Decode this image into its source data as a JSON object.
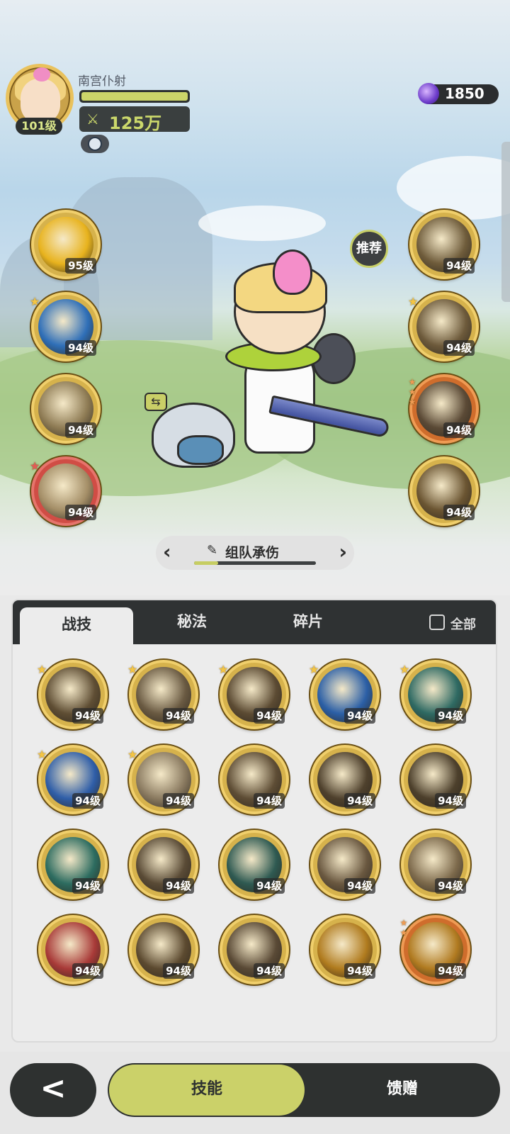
{
  "player": {
    "name": "南宫仆射",
    "level": "101级",
    "hp_fraction": 1.0,
    "power": "125万"
  },
  "currency": {
    "icon": "purple-gem-icon",
    "amount": "1850"
  },
  "recommend_label": "推荐",
  "left_skills": [
    {
      "level": "95级",
      "star": "",
      "theme": "gold",
      "fill": "#e8b31e"
    },
    {
      "level": "94级",
      "star": "★",
      "theme": "gold",
      "fill": "#2f6fb8"
    },
    {
      "level": "94级",
      "star": "",
      "theme": "gold",
      "fill": "#8e7b54"
    },
    {
      "level": "94级",
      "star": "★",
      "theme": "red",
      "fill": "#a48e67"
    }
  ],
  "right_skills": [
    {
      "level": "94级",
      "star": "",
      "theme": "gold",
      "fill": "#6f5c3b"
    },
    {
      "level": "94级",
      "star": "★",
      "theme": "gold",
      "fill": "#6d5a3b"
    },
    {
      "level": "94级",
      "star": "★★★",
      "theme": "orange",
      "fill": "#5b4a36"
    },
    {
      "level": "94级",
      "star": "",
      "theme": "gold",
      "fill": "#6b5532"
    }
  ],
  "preset": {
    "name": "组队承伤",
    "progress": 0.2
  },
  "tabs": [
    {
      "label": "战技",
      "active": true
    },
    {
      "label": "秘法",
      "active": false
    },
    {
      "label": "碎片",
      "active": false
    }
  ],
  "filter_all_label": "全部",
  "grid_skills": [
    {
      "level": "94级",
      "star": "★",
      "theme": "gold",
      "fill": "#5f4e34"
    },
    {
      "level": "94级",
      "star": "★",
      "theme": "gold",
      "fill": "#6a5a42"
    },
    {
      "level": "94级",
      "star": "★",
      "theme": "gold",
      "fill": "#5c4b33"
    },
    {
      "level": "94级",
      "star": "★",
      "theme": "gold",
      "fill": "#2b5fa6"
    },
    {
      "level": "94级",
      "star": "★",
      "theme": "gold",
      "fill": "#2f6a63"
    },
    {
      "level": "94级",
      "star": "★",
      "theme": "gold",
      "fill": "#2f5ea8"
    },
    {
      "level": "94级",
      "star": "★",
      "theme": "gold",
      "fill": "#8a7a60"
    },
    {
      "level": "94级",
      "star": "",
      "theme": "gold",
      "fill": "#5e4d35"
    },
    {
      "level": "94级",
      "star": "",
      "theme": "gold",
      "fill": "#4f412d"
    },
    {
      "level": "94级",
      "star": "",
      "theme": "gold",
      "fill": "#4d402c"
    },
    {
      "level": "94级",
      "star": "",
      "theme": "gold",
      "fill": "#2d6c60"
    },
    {
      "level": "94级",
      "star": "",
      "theme": "gold",
      "fill": "#5a4b36"
    },
    {
      "level": "94级",
      "star": "",
      "theme": "gold",
      "fill": "#2f5a52"
    },
    {
      "level": "94级",
      "star": "",
      "theme": "gold",
      "fill": "#6a5840"
    },
    {
      "level": "94级",
      "star": "",
      "theme": "gold",
      "fill": "#7d6a4c"
    },
    {
      "level": "94级",
      "star": "",
      "theme": "gold",
      "fill": "#a83a38"
    },
    {
      "level": "94级",
      "star": "",
      "theme": "gold",
      "fill": "#5c4a30"
    },
    {
      "level": "94级",
      "star": "",
      "theme": "gold",
      "fill": "#5a4a36"
    },
    {
      "level": "94级",
      "star": "",
      "theme": "gold",
      "fill": "#b07b1e"
    },
    {
      "level": "94级",
      "star": "★★",
      "theme": "orange",
      "fill": "#b07a20"
    }
  ],
  "bottom": {
    "back_icon": "chevron-left-icon",
    "tab_skill": "技能",
    "tab_gift": "馈赠"
  },
  "colors": {
    "accent": "#cbd169",
    "dark": "#2e3130",
    "gold_ring": "#f0cf6c"
  }
}
